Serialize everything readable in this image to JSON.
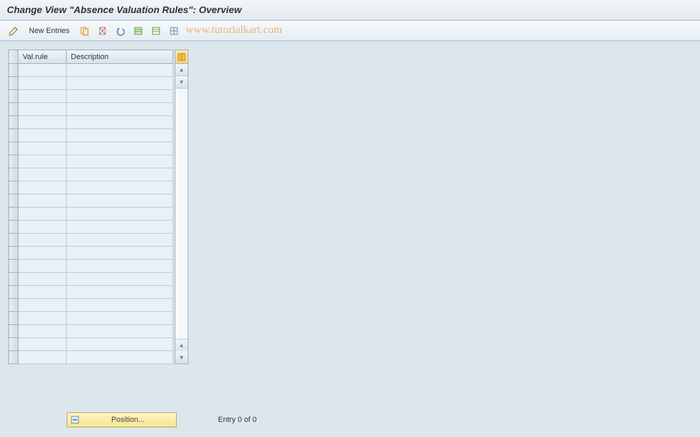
{
  "header": {
    "title": "Change View \"Absence Valuation Rules\": Overview"
  },
  "toolbar": {
    "new_entries_label": "New Entries"
  },
  "watermark": "www.tutorialkart.com",
  "table": {
    "columns": {
      "valrule": "Val.rule",
      "description": "Description"
    },
    "rows": [
      {
        "valrule": "",
        "description": ""
      },
      {
        "valrule": "",
        "description": ""
      },
      {
        "valrule": "",
        "description": ""
      },
      {
        "valrule": "",
        "description": ""
      },
      {
        "valrule": "",
        "description": ""
      },
      {
        "valrule": "",
        "description": ""
      },
      {
        "valrule": "",
        "description": ""
      },
      {
        "valrule": "",
        "description": ""
      },
      {
        "valrule": "",
        "description": ""
      },
      {
        "valrule": "",
        "description": ""
      },
      {
        "valrule": "",
        "description": ""
      },
      {
        "valrule": "",
        "description": ""
      },
      {
        "valrule": "",
        "description": ""
      },
      {
        "valrule": "",
        "description": ""
      },
      {
        "valrule": "",
        "description": ""
      },
      {
        "valrule": "",
        "description": ""
      },
      {
        "valrule": "",
        "description": ""
      },
      {
        "valrule": "",
        "description": ""
      },
      {
        "valrule": "",
        "description": ""
      },
      {
        "valrule": "",
        "description": ""
      },
      {
        "valrule": "",
        "description": ""
      },
      {
        "valrule": "",
        "description": ""
      },
      {
        "valrule": "",
        "description": ""
      }
    ]
  },
  "footer": {
    "position_label": "Position...",
    "entry_status": "Entry 0 of 0"
  }
}
